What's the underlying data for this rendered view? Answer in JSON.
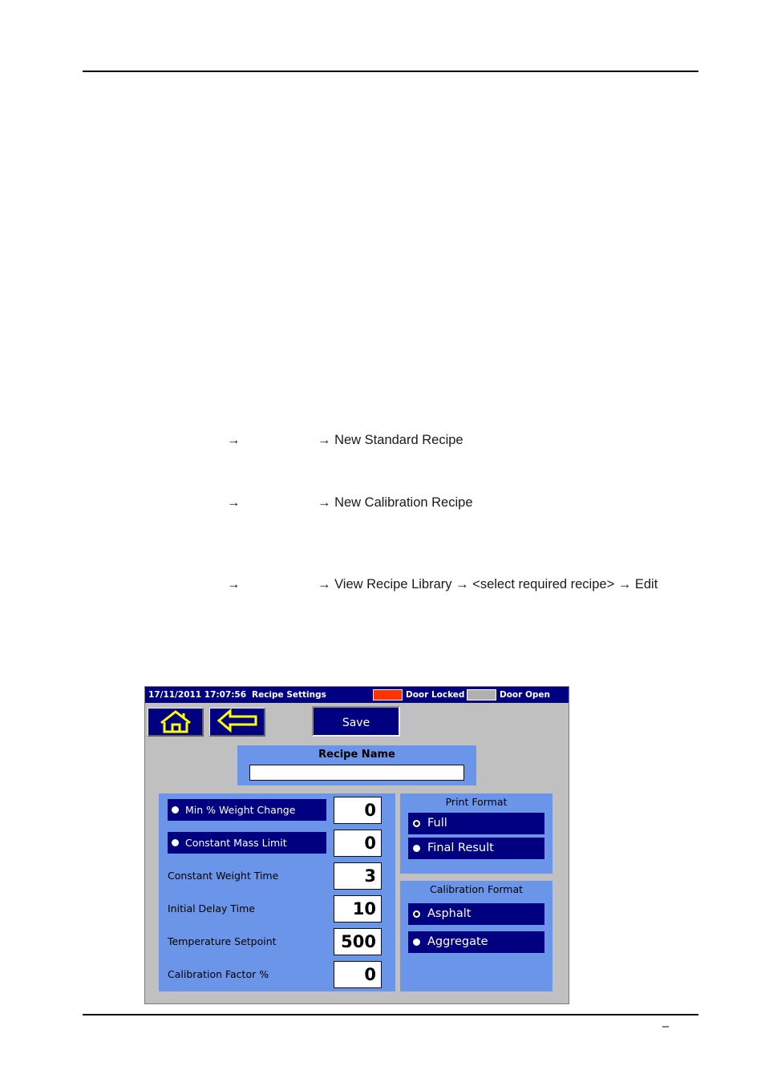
{
  "document": {
    "page_number": "–",
    "procedure_lines": [
      {
        "lead_arrow": "→",
        "text": "→ New Standard Recipe"
      },
      {
        "lead_arrow": "→",
        "text": "→ New Calibration Recipe"
      },
      {
        "lead_arrow": "→",
        "text": "→ View Recipe Library → <select required recipe> → Edit"
      }
    ]
  },
  "hmi": {
    "statusbar": {
      "datetime": "17/11/2011 17:07:56",
      "screen_title": "Recipe Settings",
      "door_locked_label": "Door Locked",
      "door_locked_color": "#ff3300",
      "door_open_label": "Door Open",
      "door_open_color": "#b0b0b0"
    },
    "toolbar": {
      "home_icon": "home-icon",
      "back_icon": "back-arrow-icon",
      "save_label": "Save"
    },
    "recipe_name": {
      "label": "Recipe Name",
      "value": "",
      "placeholder": ""
    },
    "parameters": [
      {
        "label": "Min % Weight Change",
        "value": "0",
        "style": "chip",
        "radio": "on"
      },
      {
        "label": "Constant Mass Limit",
        "value": "0",
        "style": "chip",
        "radio": "on"
      },
      {
        "label": "Constant Weight Time",
        "value": "3",
        "style": "plain",
        "radio": "none"
      },
      {
        "label": "Initial Delay Time",
        "value": "10",
        "style": "plain",
        "radio": "none"
      },
      {
        "label": "Temperature Setpoint",
        "value": "500",
        "style": "plain",
        "radio": "none"
      },
      {
        "label": "Calibration Factor %",
        "value": "0",
        "style": "plain",
        "radio": "none"
      }
    ],
    "print_format": {
      "title": "Print Format",
      "options": [
        {
          "label": "Full",
          "selected": false
        },
        {
          "label": "Final Result",
          "selected": true
        }
      ]
    },
    "calibration_format": {
      "title": "Calibration Format",
      "options": [
        {
          "label": "Asphalt",
          "selected": false
        },
        {
          "label": "Aggregate",
          "selected": true
        }
      ]
    },
    "colors": {
      "window_bg": "#c0c0c0",
      "panel_blue": "#6b95e8",
      "navy": "#000080",
      "accent_yellow": "#ffff00"
    }
  }
}
